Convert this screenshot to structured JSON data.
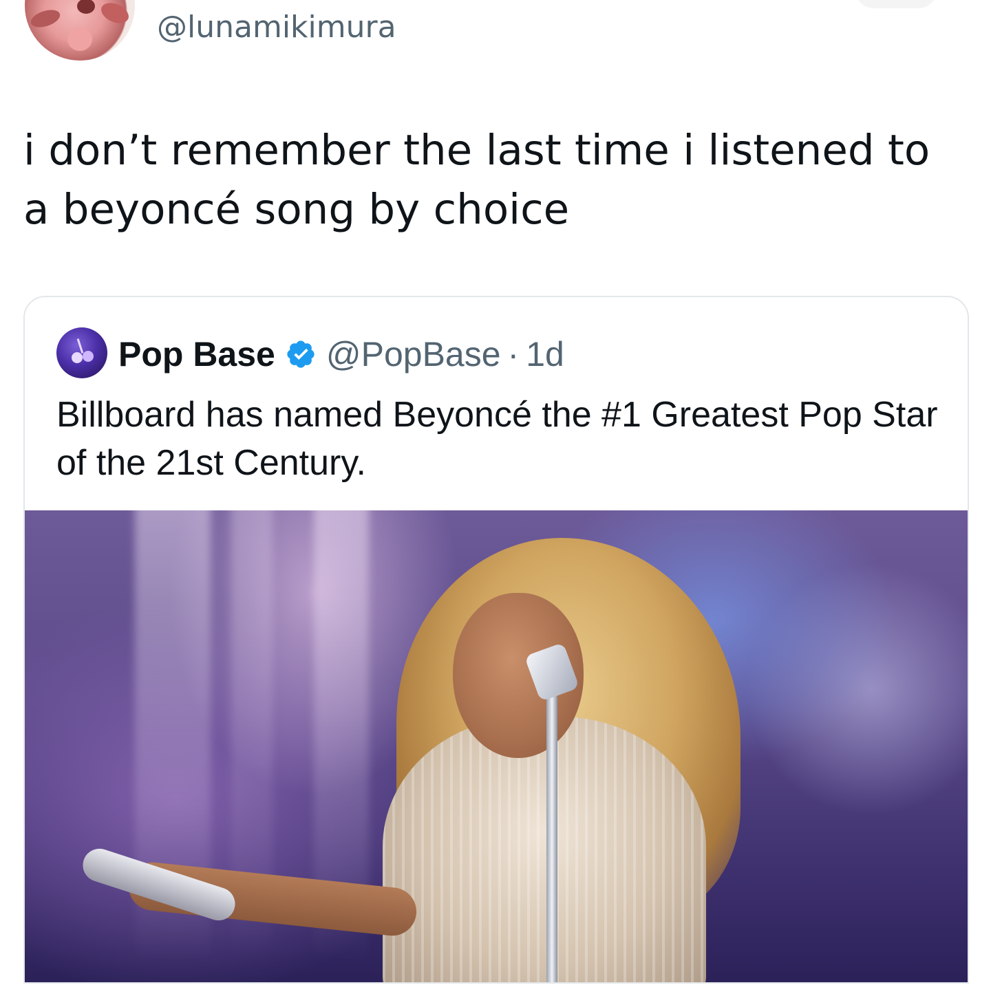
{
  "author": {
    "handle": "@lunamikimura",
    "avatar_icon": "profile-avatar"
  },
  "tweet": {
    "text": "i don’t remember the last time i listened to a beyoncé song by choice"
  },
  "quoted_tweet": {
    "name": "Pop Base",
    "verified_icon": "verified-badge-icon",
    "verified_color": "#1d9bf0",
    "handle": "@PopBase",
    "separator": "·",
    "time": "1d",
    "text": "Billboard has named Beyoncé the #1 Greatest Pop Star of the 21st Century.",
    "avatar_icon": "cherry-avatar"
  },
  "colors": {
    "text_primary": "#0f1419",
    "text_secondary": "#536471",
    "border": "#e3e7ea"
  }
}
